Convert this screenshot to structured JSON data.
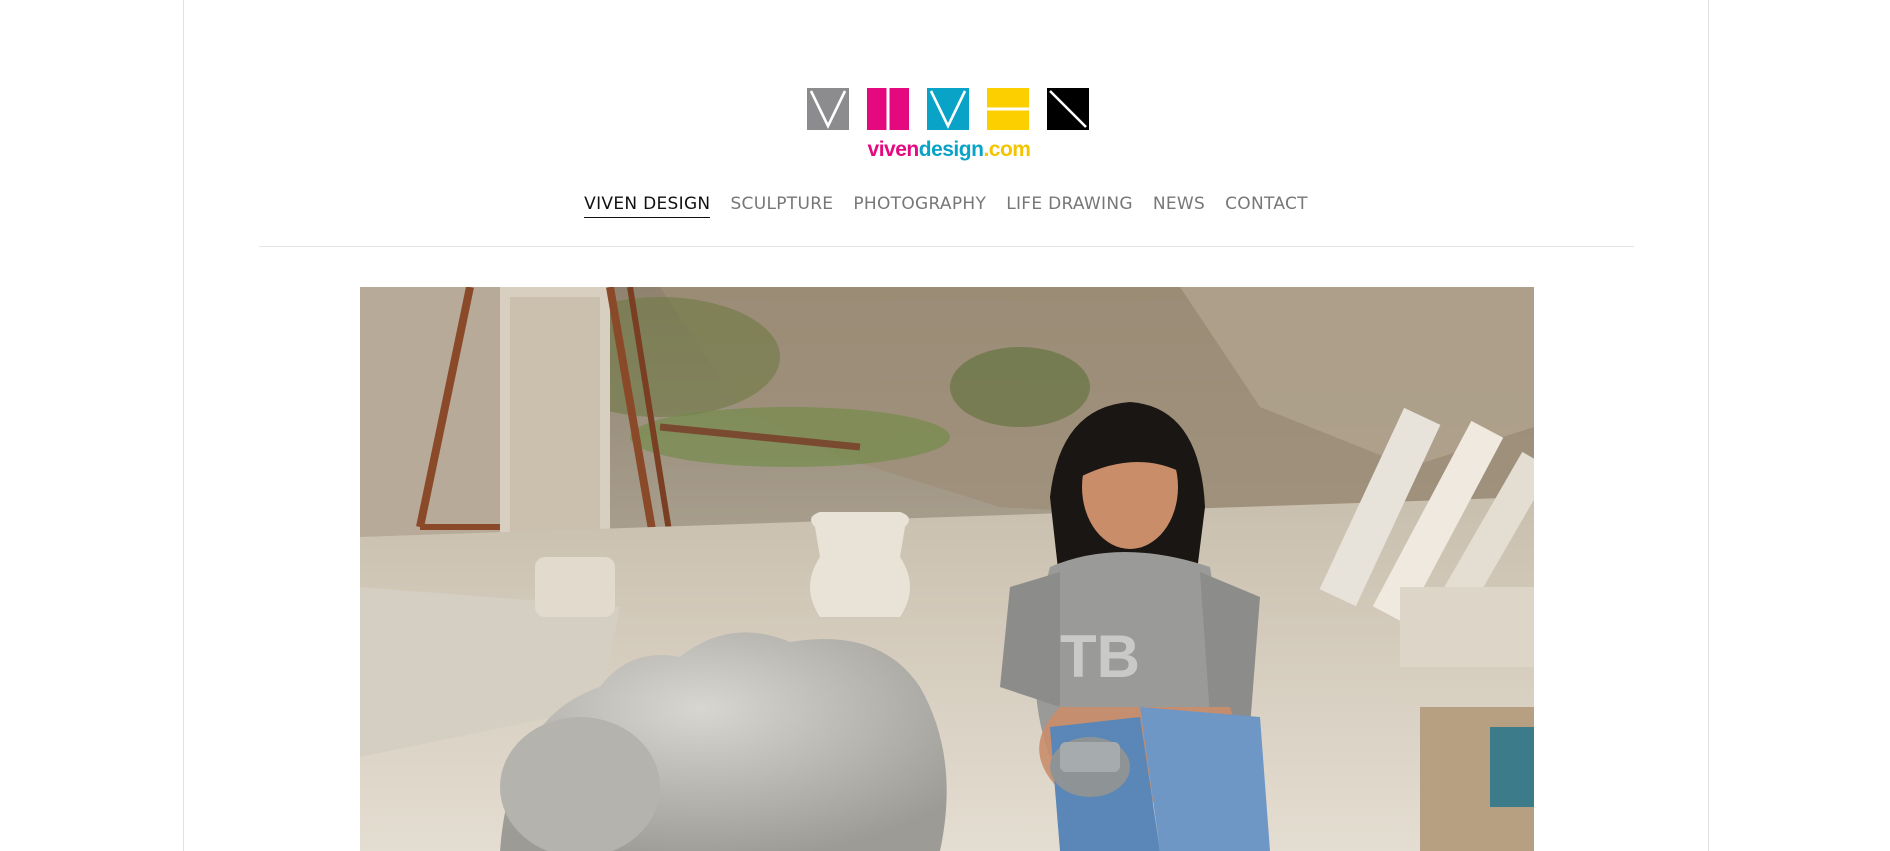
{
  "brand": {
    "wordmark_a": "viven",
    "wordmark_b": "design",
    "wordmark_c": ".com",
    "colors": {
      "gray": "#8c8c8e",
      "magenta": "#e5097f",
      "cyan": "#0aa3c8",
      "yellow": "#fcd000",
      "black": "#000000"
    }
  },
  "nav": {
    "items": [
      {
        "label": "VIVEN DESIGN",
        "active": true
      },
      {
        "label": "SCULPTURE",
        "active": false
      },
      {
        "label": "PHOTOGRAPHY",
        "active": false
      },
      {
        "label": "LIFE DRAWING",
        "active": false
      },
      {
        "label": "NEWS",
        "active": false
      },
      {
        "label": "CONTACT",
        "active": false
      }
    ]
  },
  "hero": {
    "icon": "photo-sculptor-at-work"
  }
}
